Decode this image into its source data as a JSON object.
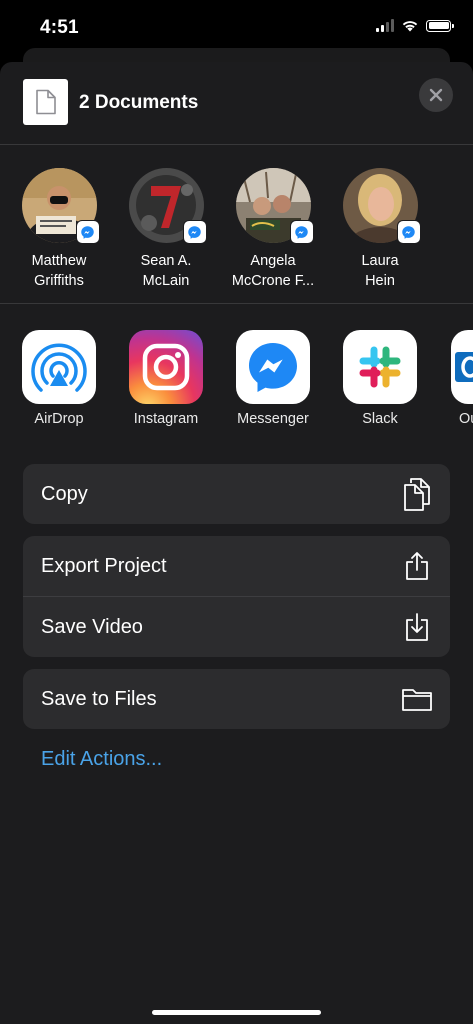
{
  "status": {
    "time": "4:51"
  },
  "header": {
    "title": "2 Documents"
  },
  "people": [
    {
      "name_line1": "Matthew",
      "name_line2": "Griffiths"
    },
    {
      "name_line1": "Sean A.",
      "name_line2": "McLain"
    },
    {
      "name_line1": "Angela",
      "name_line2": "McCrone F..."
    },
    {
      "name_line1": "Laura",
      "name_line2": "Hein"
    }
  ],
  "apps": [
    {
      "label": "AirDrop",
      "icon": "airdrop-icon"
    },
    {
      "label": "Instagram",
      "icon": "instagram-icon"
    },
    {
      "label": "Messenger",
      "icon": "messenger-icon"
    },
    {
      "label": "Slack",
      "icon": "slack-icon"
    },
    {
      "label": "Ou",
      "icon": "outlook-icon"
    }
  ],
  "actions": {
    "copy": "Copy",
    "export_project": "Export Project",
    "save_video": "Save Video",
    "save_to_files": "Save to Files",
    "edit_actions": "Edit Actions..."
  },
  "colors": {
    "sheet_bg": "#1c1c1e",
    "row_bg": "#2c2c2e",
    "link": "#4aa3e8",
    "messenger": "#1e88f5"
  }
}
